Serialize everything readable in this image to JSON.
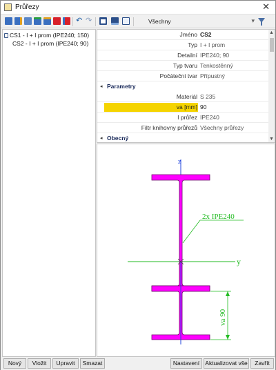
{
  "window": {
    "title": "Průřezy",
    "close_glyph": "✕"
  },
  "toolbar": {
    "icons": [
      "add-section-icon",
      "edit-section-icon",
      "copy-section-icon",
      "import-section-icon",
      "export-section-icon",
      "delete-icon",
      "delete-all-icon",
      "duplicate-icon",
      "undo-icon",
      "redo-icon",
      "table-icon",
      "save-icon",
      "report-icon"
    ],
    "filter_value": "Všechny",
    "filter_chevron": "▾"
  },
  "tree": {
    "items": [
      {
        "label": "CS1 - I + I prom (IPE240; 150)",
        "locked": true
      },
      {
        "label": "CS2 - I + I prom (IPE240; 90)",
        "locked": false
      }
    ]
  },
  "properties": {
    "rows": [
      {
        "label": "Jméno",
        "value": "CS2"
      },
      {
        "label": "Typ",
        "value": "I + I prom"
      },
      {
        "label": "Detailní",
        "value": "IPE240; 90"
      },
      {
        "label": "Typ tvaru",
        "value": "Tenkostěnný"
      },
      {
        "label": "Počáteční tvar",
        "value": "Přípustný"
      }
    ],
    "section_parametry": "Parametry",
    "param_rows": [
      {
        "label": "Materiál",
        "value": "S 235"
      },
      {
        "label": "va [mm]",
        "value": "90"
      },
      {
        "label": "I průřez",
        "value": "IPE240"
      },
      {
        "label": "Filtr knihovny průřezů",
        "value": "Všechny průřezy"
      }
    ],
    "section_obecny": "Obecný",
    "collapse_glyph": "◂",
    "expand_glyph": "◂"
  },
  "drawing": {
    "axis_z": "z",
    "axis_y": "y",
    "annotation": "2x IPE240",
    "dimension": "va 90",
    "colors": {
      "section": "#ff00ff",
      "axis": "#22bb22",
      "z_axis": "#2244dd",
      "dimension": "#22bb22"
    }
  },
  "buttons": {
    "new": "Nový",
    "insert": "Vložit",
    "edit": "Upravit",
    "delete": "Smazat",
    "settings": "Nastavení",
    "update_all": "Aktualizovat vše",
    "close": "Zavřít"
  }
}
